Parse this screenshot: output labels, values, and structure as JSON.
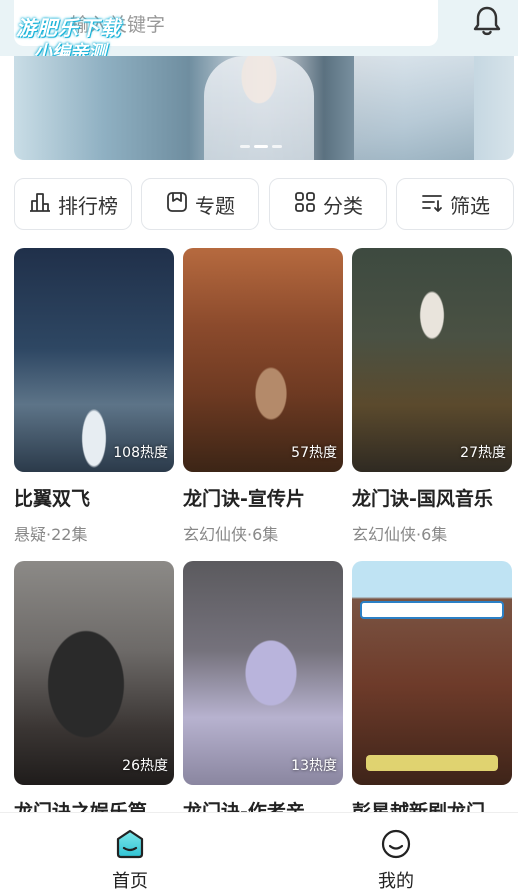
{
  "search": {
    "placeholder": "输入关键字"
  },
  "watermark": {
    "line1": "游肥乐下载",
    "line2": "小编亲测"
  },
  "banner": {
    "slides": 3,
    "active_index": 1
  },
  "categories": [
    {
      "label": "排行榜",
      "icon": "ranking-icon"
    },
    {
      "label": "专题",
      "icon": "topic-icon"
    },
    {
      "label": "分类",
      "icon": "category-grid-icon"
    },
    {
      "label": "筛选",
      "icon": "filter-icon"
    }
  ],
  "items": [
    {
      "title": "比翼双飞",
      "subtitle": "悬疑·22集",
      "heat": "108热度"
    },
    {
      "title": "龙门诀-宣传片",
      "subtitle": "玄幻仙侠·6集",
      "heat": "57热度"
    },
    {
      "title": "龙门诀-国风音乐",
      "subtitle": "玄幻仙侠·6集",
      "heat": "27热度"
    },
    {
      "title": "龙门诀之娱乐篇",
      "subtitle": "",
      "heat": "26热度"
    },
    {
      "title": "龙门诀-作者亲…",
      "subtitle": "",
      "heat": "13热度"
    },
    {
      "title": "彭星越新剧龙门…",
      "subtitle": "",
      "heat": ""
    }
  ],
  "bottom_nav": [
    {
      "label": "首页",
      "active": true
    },
    {
      "label": "我的",
      "active": false
    }
  ],
  "colors": {
    "accent": "#2fc3d4",
    "top_bg": "#e9f3f6"
  }
}
